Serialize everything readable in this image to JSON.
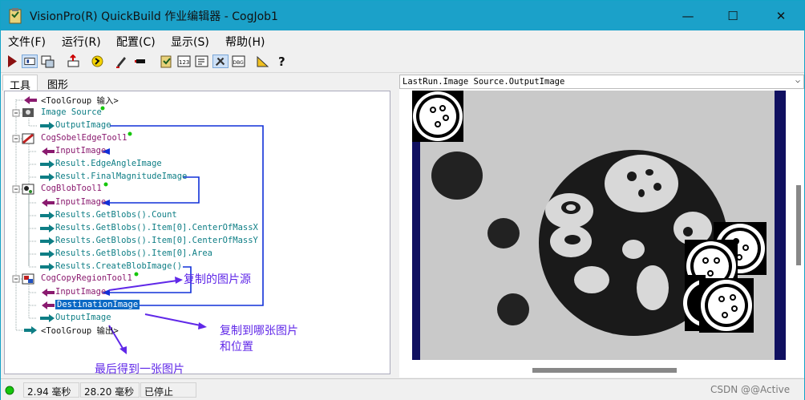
{
  "window": {
    "title": "VisionPro(R) QuickBuild 作业编辑器 - CogJob1",
    "minimize": "—",
    "maximize": "☐",
    "close": "✕"
  },
  "menu": [
    "文件(F)",
    "运行(R)",
    "配置(C)",
    "显示(S)",
    "帮助(H)"
  ],
  "tabs": [
    "工具",
    "图形"
  ],
  "tree": [
    {
      "text": "<ToolGroup 输入>"
    },
    {
      "text": "Image Source"
    },
    {
      "text": "OutputImage"
    },
    {
      "text": "CogSobelEdgeTool1"
    },
    {
      "text": "InputImage"
    },
    {
      "text": "Result.EdgeAngleImage"
    },
    {
      "text": "Result.FinalMagnitudeImage"
    },
    {
      "text": "CogBlobTool1"
    },
    {
      "text": "InputImage"
    },
    {
      "text": "Results.GetBlobs().Count"
    },
    {
      "text": "Results.GetBlobs().Item[0].CenterOfMassX"
    },
    {
      "text": "Results.GetBlobs().Item[0].CenterOfMassY"
    },
    {
      "text": "Results.GetBlobs().Item[0].Area"
    },
    {
      "text": "Results.CreateBlobImage()"
    },
    {
      "text": "CogCopyRegionTool1"
    },
    {
      "text": "InputImage"
    },
    {
      "text": "DestinationImage"
    },
    {
      "text": "OutputImage"
    },
    {
      "text": "<ToolGroup 输出>"
    }
  ],
  "annotations": [
    "复制的图片源",
    "复制到哪张图片",
    "和位置",
    "最后得到一张图片"
  ],
  "image_view": {
    "source": "LastRun.Image Source.OutputImage"
  },
  "status": [
    "2.94 毫秒",
    "28.20 毫秒",
    "已停止"
  ],
  "watermark": "CSDN @@Active",
  "colors": {
    "titlebar": "#1ba1c9",
    "selection": "#0a68c4",
    "annotation": "#6028e8",
    "link_line": "#1030d8"
  }
}
